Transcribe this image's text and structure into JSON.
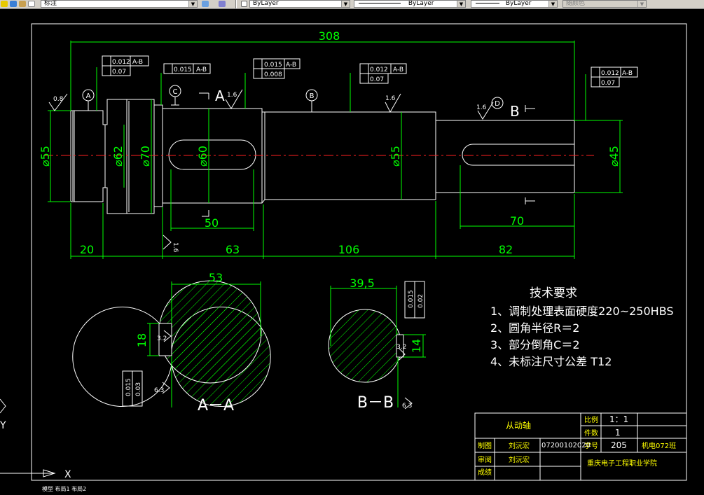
{
  "toolbar": {
    "layer_name": "标注",
    "color": "ByLayer",
    "linetype": "ByLayer",
    "lineweight": "ByLayer",
    "plotstyle": "随颜色"
  },
  "dims": {
    "total_length": "308",
    "len_20": "20",
    "len_63": "63",
    "len_106": "106",
    "len_82": "82",
    "len_50": "50",
    "len_70": "70",
    "dia_55_left": "⌀55",
    "dia_62": "⌀62",
    "dia_70": "⌀70",
    "dia_60": "⌀60",
    "dia_55_mid": "⌀55",
    "dia_45": "⌀45",
    "sec_a_width": "53",
    "sec_a_key": "18",
    "sec_b_width": "39,5",
    "sec_b_key": "14"
  },
  "datums": {
    "a": "A",
    "b": "B",
    "c": "C",
    "d": "D"
  },
  "tolerance": {
    "t1_v1": "0.012",
    "t1_r1": "A-B",
    "t1_v2": "0.07",
    "t2_v1": "0.015",
    "t2_r1": "A-B",
    "t3_v1": "0.015",
    "t3_r1": "A-B",
    "t3_v2": "0.008",
    "t4_v1": "0.012",
    "t4_r1": "A-B",
    "t4_v2": "0.07",
    "t5_v1": "0.012",
    "t5_r1": "A-B",
    "t5_v2": "0.07",
    "sec_a_v1": "0.015",
    "sec_a_v2": "0.03",
    "sec_b_v1": "0.015",
    "sec_b_v2": "0.02"
  },
  "roughness": {
    "r08": "0.8",
    "r16a": "1.6",
    "r16b": "1.6",
    "r16c": "1.6",
    "r16d": "1.6",
    "r32a": "3.2",
    "r32b": "3.2",
    "r63a": "6.3",
    "r63b": "6.3"
  },
  "section_marks": {
    "a_arrow": "A",
    "b_arrow": "B",
    "aa": "A－A",
    "bb": "B－B"
  },
  "requirements": {
    "title": "技术要求",
    "item1": "1、调制处理表面硬度220~250HBS",
    "item2": "2、圆角半径R＝2",
    "item3": "3、部分倒角C＝2",
    "item4": "4、未标注尺寸公差 T12"
  },
  "title_block": {
    "part_name": "从动轴",
    "scale_label": "比例",
    "scale_value": "1：1",
    "qty_label": "件数",
    "qty_value": "1",
    "draw_label": "制图",
    "drafter": "刘沅宏",
    "student_no": "07200102020",
    "no_label": "学号",
    "no_value": "205",
    "class": "机电072班",
    "check_label": "审阅",
    "checker": "刘沅宏",
    "school": "重庆电子工程职业学院",
    "grade_label": "成绩"
  },
  "ucs": {
    "x": "X",
    "y": "Y"
  },
  "command_line": "模型 布局1 布局2"
}
